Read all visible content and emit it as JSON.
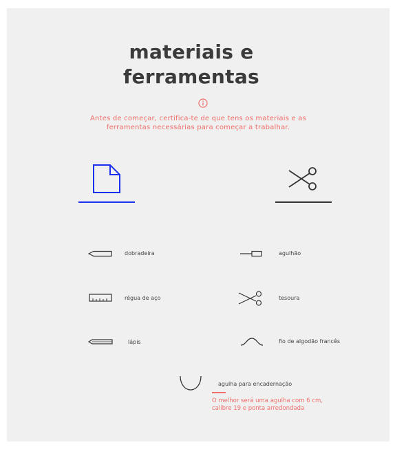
{
  "page": {
    "title_line1": "materiais e",
    "title_line2": "ferramentas",
    "notice_line1": "Antes de começar, certifica-te de que tens os materiais e as",
    "notice_line2": "ferramentas necessárias para começar a trabalhar."
  },
  "tabs": [
    {
      "name": "materials",
      "icon": "paper-icon",
      "active": true,
      "color": "#1b2ff0"
    },
    {
      "name": "tools",
      "icon": "scissors-icon",
      "active": false,
      "color": "#333333"
    }
  ],
  "items": [
    {
      "label": "dobradeira",
      "icon": "bone-folder-icon"
    },
    {
      "label": "agulhão",
      "icon": "awl-icon"
    },
    {
      "label": "régua de aço",
      "icon": "ruler-icon"
    },
    {
      "label": "tesoura",
      "icon": "scissors-icon"
    },
    {
      "label": "lápis",
      "icon": "pencil-icon"
    },
    {
      "label": "fio de algodão francês",
      "icon": "thread-icon"
    },
    {
      "label": "agulha para encadernação",
      "icon": "curved-needle-icon"
    }
  ],
  "note": {
    "line1": "O melhor será uma agulha com 6 cm,",
    "line2": "calibre 19 e ponta arredondada"
  },
  "colors": {
    "accent": "#ee6f6a",
    "active_tab": "#1b2ff0",
    "text": "#3b3b3b",
    "background": "#f0f0f0"
  }
}
